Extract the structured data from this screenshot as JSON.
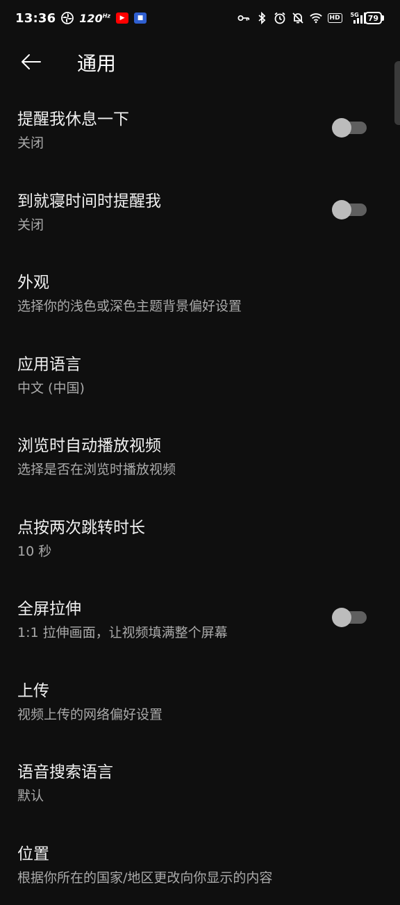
{
  "status_bar": {
    "time": "13:36",
    "refresh_rate": "120",
    "refresh_unit": "Hz",
    "network": "5G",
    "battery": "79"
  },
  "header": {
    "title": "通用"
  },
  "settings": [
    {
      "title": "提醒我休息一下",
      "subtitle": "关闭",
      "toggle": true,
      "checked": false
    },
    {
      "title": "到就寝时间时提醒我",
      "subtitle": "关闭",
      "toggle": true,
      "checked": false
    },
    {
      "title": "外观",
      "subtitle": "选择你的浅色或深色主题背景偏好设置",
      "toggle": false
    },
    {
      "title": "应用语言",
      "subtitle": "中文 (中国)",
      "toggle": false
    },
    {
      "title": "浏览时自动播放视频",
      "subtitle": "选择是否在浏览时播放视频",
      "toggle": false
    },
    {
      "title": "点按两次跳转时长",
      "subtitle": "10 秒",
      "toggle": false
    },
    {
      "title": "全屏拉伸",
      "subtitle": "1:1 拉伸画面，让视频填满整个屏幕",
      "toggle": true,
      "checked": false
    },
    {
      "title": "上传",
      "subtitle": "视频上传的网络偏好设置",
      "toggle": false
    },
    {
      "title": "语音搜索语言",
      "subtitle": "默认",
      "toggle": false
    },
    {
      "title": "位置",
      "subtitle": "根据你所在的国家/地区更改向你显示的内容",
      "toggle": false
    }
  ],
  "colors": {
    "background": "#0f0f0f",
    "text_primary": "#f1f1f1",
    "text_secondary": "#aaaaaa",
    "toggle_track_off": "#5f5f5f",
    "toggle_knob_off": "#bcbcbc"
  }
}
